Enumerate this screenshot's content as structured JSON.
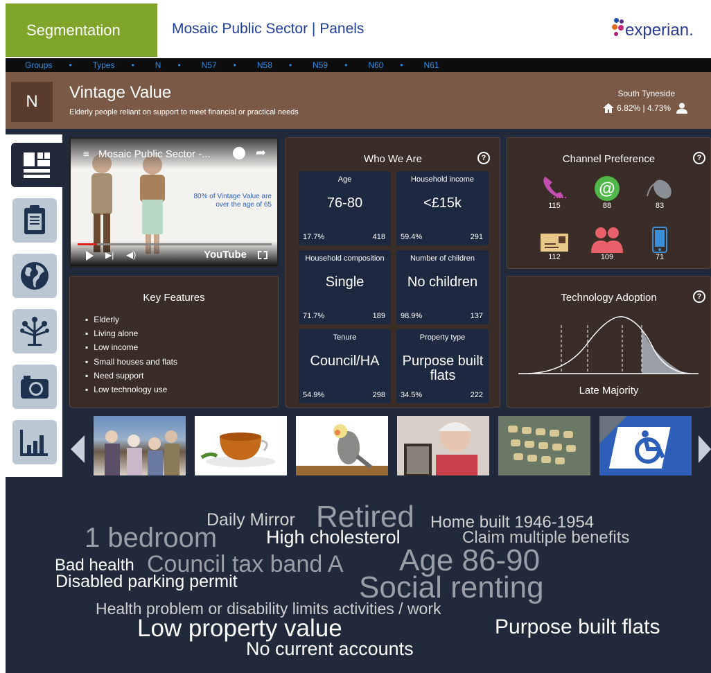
{
  "header": {
    "segmentation_tab": "Segmentation",
    "app_title": "Mosaic Public Sector | Panels",
    "logo_text": "experian."
  },
  "breadcrumb": [
    "Groups",
    "Types",
    "N",
    "N57",
    "N58",
    "N59",
    "N60",
    "N61"
  ],
  "banner": {
    "code": "N",
    "title": "Vintage Value",
    "subtitle": "Elderly people reliant on support to meet financial or practical needs",
    "area_name": "South Tyneside",
    "area_stats": "6.82% | 4.73%"
  },
  "video": {
    "title": "Mosaic Public Sector -...",
    "caption": "80% of Vintage Value are over the age of 65",
    "brand": "YouTube",
    "progress": 0.1
  },
  "key_features": {
    "title": "Key Features",
    "items": [
      "Elderly",
      "Living alone",
      "Low income",
      "Small houses and flats",
      "Need support",
      "Low technology use"
    ]
  },
  "who_we_are": {
    "title": "Who We Are",
    "help": "?",
    "tiles": [
      {
        "label": "Age",
        "value": "76-80",
        "pct": "17.7%",
        "index": "418"
      },
      {
        "label": "Household income",
        "value": "<£15k",
        "pct": "59.4%",
        "index": "291"
      },
      {
        "label": "Household composition",
        "value": "Single",
        "pct": "71.7%",
        "index": "189"
      },
      {
        "label": "Number of children",
        "value": "No children",
        "pct": "98.9%",
        "index": "137"
      },
      {
        "label": "Tenure",
        "value": "Council/HA",
        "pct": "54.9%",
        "index": "298"
      },
      {
        "label": "Property type",
        "value": "Purpose built flats",
        "pct": "34.5%",
        "index": "222"
      }
    ]
  },
  "channel_preference": {
    "title": "Channel Preference",
    "help": "?",
    "channels": [
      {
        "icon": "phone-icon",
        "value": "115",
        "color": "#c34fb0"
      },
      {
        "icon": "email-icon",
        "value": "88",
        "color": "#4fb848"
      },
      {
        "icon": "mouse-icon",
        "value": "83",
        "color": "#8a8f96"
      },
      {
        "icon": "letter-icon",
        "value": "112",
        "color": "#e8c98a"
      },
      {
        "icon": "people-icon",
        "value": "109",
        "color": "#e8606a"
      },
      {
        "icon": "mobile-icon",
        "value": "71",
        "color": "#3a8fd8"
      }
    ]
  },
  "technology_adoption": {
    "title": "Technology Adoption",
    "help": "?",
    "label": "Late Majority"
  },
  "sidenav": [
    "dashboard-icon",
    "clipboard-icon",
    "globe-icon",
    "tree-icon",
    "camera-icon",
    "bar-chart-icon"
  ],
  "photos": [
    "elderly-group-photo",
    "tea-cup-photo",
    "cockatiel-photo",
    "elderly-woman-photo",
    "pill-pack-photo",
    "disabled-parking-photo"
  ],
  "word_cloud": [
    {
      "text": "Daily Mirror",
      "color": "#d0d0d0"
    },
    {
      "text": "Retired",
      "color": "#9a9ea6"
    },
    {
      "text": "Home built 1946-1954",
      "color": "#d0d0d0"
    },
    {
      "text": "1 bedroom",
      "color": "#9a9ea6"
    },
    {
      "text": "High cholesterol",
      "color": "#ffffff"
    },
    {
      "text": "Claim multiple benefits",
      "color": "#c8c8c8"
    },
    {
      "text": "Bad health",
      "color": "#ffffff"
    },
    {
      "text": "Council tax band A",
      "color": "#9a9ea6"
    },
    {
      "text": "Age 86-90",
      "color": "#9a9ea6"
    },
    {
      "text": "Disabled parking permit",
      "color": "#ffffff"
    },
    {
      "text": "Social renting",
      "color": "#9a9ea6"
    },
    {
      "text": "Health problem or disability limits activities / work",
      "color": "#d0d0d0"
    },
    {
      "text": "Low property value",
      "color": "#ffffff"
    },
    {
      "text": "Purpose built flats",
      "color": "#ffffff"
    },
    {
      "text": "No current accounts",
      "color": "#ffffff"
    }
  ]
}
